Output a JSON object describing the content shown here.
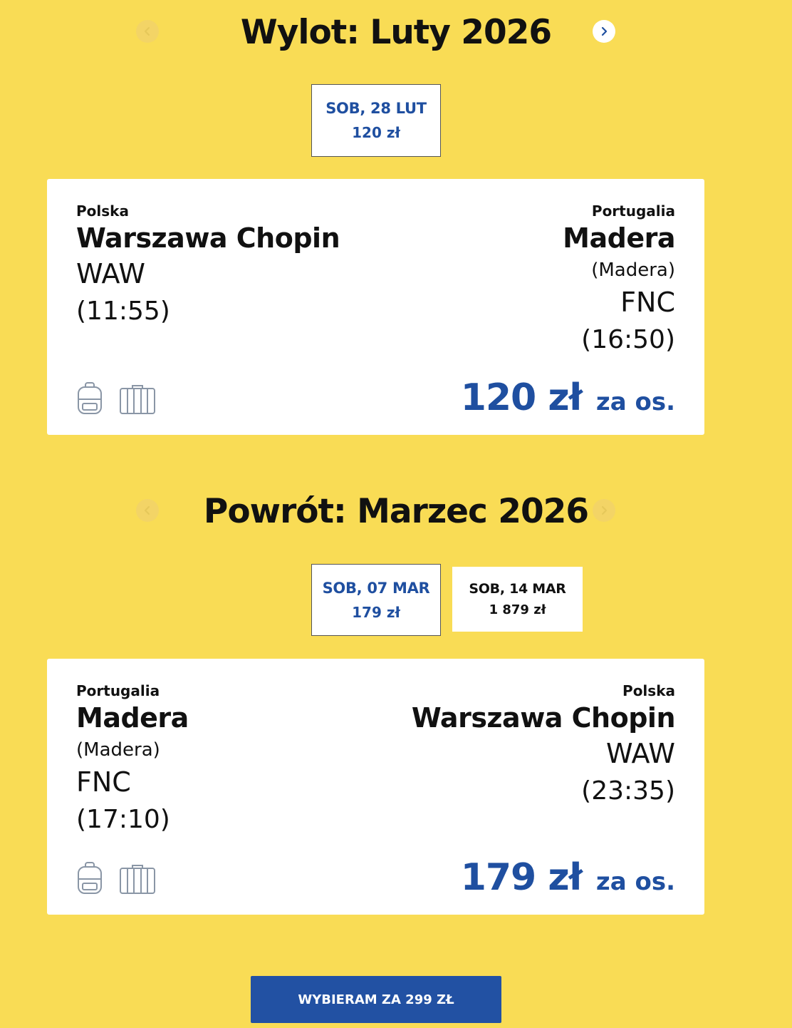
{
  "outbound": {
    "title": "Wylot: Luty 2026",
    "dates": [
      {
        "day": "SOB, 28 LUT",
        "price": "120 zł"
      }
    ],
    "flight": {
      "from_country": "Polska",
      "from_airport": "Warszawa Chopin",
      "from_code": "WAW",
      "from_time": "(11:55)",
      "to_country": "Portugalia",
      "to_airport": "Madera",
      "to_region": "(Madera)",
      "to_code": "FNC",
      "to_time": "(16:50)",
      "price": "120 zł",
      "per_person": "za os."
    }
  },
  "return": {
    "title": "Powrót: Marzec 2026",
    "dates": [
      {
        "day": "SOB, 07 MAR",
        "price": "179 zł"
      },
      {
        "day": "SOB, 14 MAR",
        "price": "1 879 zł"
      }
    ],
    "flight": {
      "from_country": "Portugalia",
      "from_airport": "Madera",
      "from_region": "(Madera)",
      "from_code": "FNC",
      "from_time": "(17:10)",
      "to_country": "Polska",
      "to_airport": "Warszawa Chopin",
      "to_code": "WAW",
      "to_time": "(23:35)",
      "price": "179 zł",
      "per_person": "za os."
    }
  },
  "cta": {
    "label": "WYBIERAM ZA 299 ZŁ"
  },
  "icons": {
    "prev": "chevron-left-icon",
    "next": "chevron-right-icon",
    "backpack": "backpack-icon",
    "suitcase": "suitcase-icon"
  },
  "colors": {
    "background": "#f9dc55",
    "accent": "#1f4fa0",
    "button": "#2251a3"
  }
}
